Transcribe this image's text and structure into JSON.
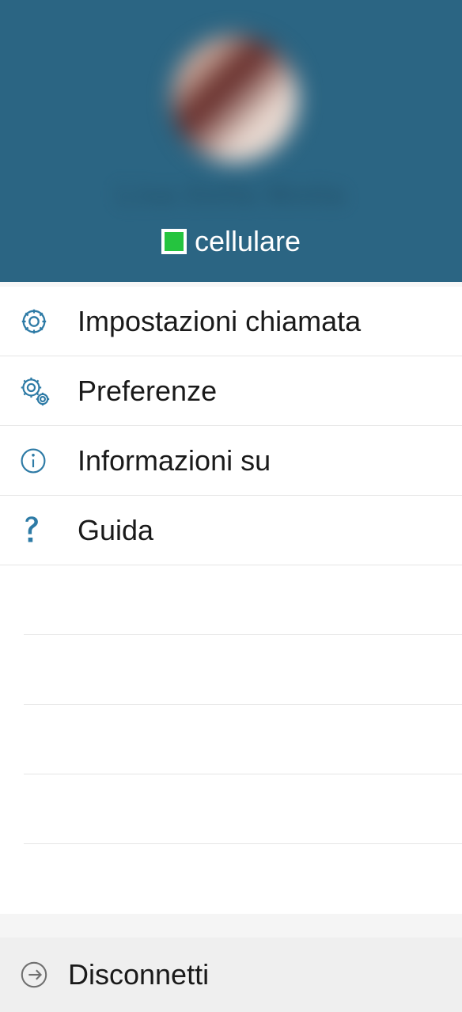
{
  "header": {
    "username_obscured": "Lisa Della Motta",
    "status_label": "cellulare",
    "status_color": "#25c43f"
  },
  "menu": {
    "items": [
      {
        "icon": "gear-icon",
        "label": "Impostazioni chiamata"
      },
      {
        "icon": "gears-icon",
        "label": "Preferenze"
      },
      {
        "icon": "info-icon",
        "label": "Informazioni su"
      },
      {
        "icon": "help-icon",
        "label": "Guida"
      }
    ]
  },
  "disconnect": {
    "label": "Disconnetti"
  }
}
